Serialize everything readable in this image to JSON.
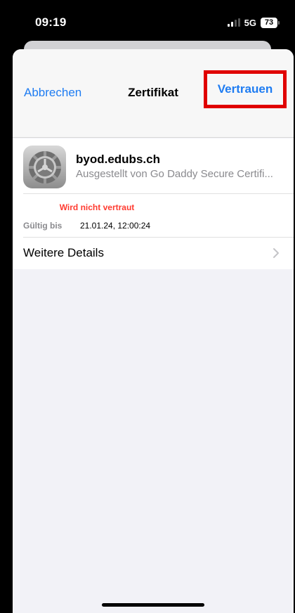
{
  "status_bar": {
    "time": "09:19",
    "network": "5G",
    "battery": "73"
  },
  "nav": {
    "cancel_label": "Abbrechen",
    "title": "Zertifikat",
    "trust_label": "Vertrauen"
  },
  "certificate": {
    "name": "byod.edubs.ch",
    "issuer": "Ausgestellt von Go Daddy Secure Certifi...",
    "status": "Wird nicht vertraut",
    "valid_label": "Gültig bis",
    "valid_value": "21.01.24, 12:00:24",
    "details_label": "Weitere Details"
  },
  "colors": {
    "accent": "#1e7cf2",
    "warning": "#ff3b30",
    "highlight_box": "#e00000"
  },
  "icons": {
    "settings": "gear-icon",
    "chevron": "chevron-right-icon"
  }
}
